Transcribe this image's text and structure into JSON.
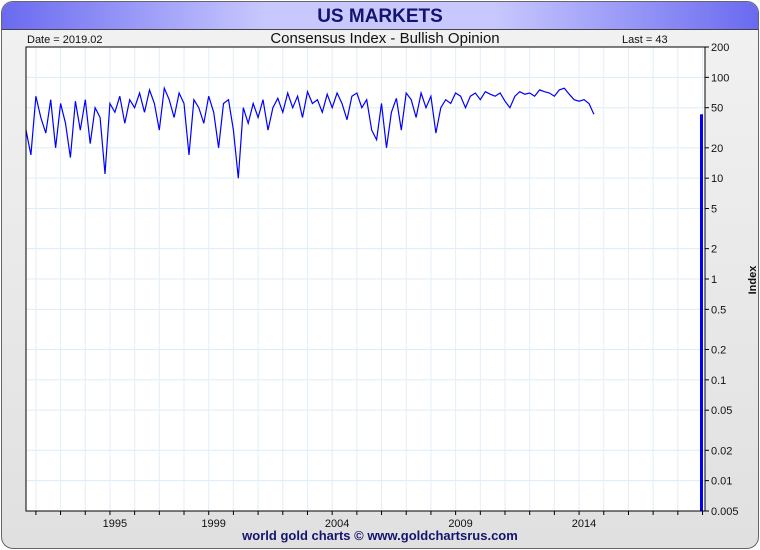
{
  "header": {
    "title": "US MARKETS"
  },
  "info": {
    "date": "Date = 2019.02",
    "last": "Last = 43"
  },
  "footer": {
    "credit": "world gold charts © www.goldchartsrus.com"
  },
  "chart_data": {
    "type": "line",
    "title": "Consensus Index - Bullish Opinion",
    "ylabel": "Index",
    "yscale": "log",
    "ylim": [
      0.005,
      200
    ],
    "yticks": [
      "200",
      "100",
      "50",
      "20",
      "10",
      "5",
      "2",
      "1",
      "0.5",
      "0.2",
      "0.1",
      "0.05",
      "0.02",
      "0.01",
      "0.005"
    ],
    "xticks": [
      "1995",
      "1999",
      "2004",
      "2009",
      "2014"
    ],
    "xlim": [
      1991.6,
      2019.1
    ],
    "grid": true,
    "series": [
      {
        "name": "Consensus Index",
        "color": "#0000ff",
        "x_start": 1991.6,
        "x_step": 0.2,
        "values": [
          30,
          17,
          65,
          40,
          28,
          60,
          20,
          55,
          35,
          16,
          58,
          30,
          60,
          22,
          50,
          40,
          11,
          55,
          45,
          65,
          35,
          60,
          50,
          70,
          45,
          75,
          55,
          30,
          78,
          60,
          40,
          70,
          55,
          17,
          60,
          50,
          35,
          65,
          45,
          20,
          55,
          60,
          30,
          10,
          50,
          35,
          55,
          40,
          60,
          30,
          50,
          62,
          45,
          70,
          50,
          65,
          40,
          72,
          55,
          60,
          45,
          68,
          50,
          70,
          55,
          38,
          65,
          70,
          50,
          60,
          30,
          24,
          55,
          20,
          45,
          62,
          30,
          70,
          60,
          40,
          70,
          50,
          65,
          28,
          50,
          60,
          55,
          70,
          65,
          50,
          65,
          70,
          60,
          72,
          68,
          65,
          70,
          58,
          50,
          65,
          72,
          68,
          70,
          65,
          75,
          72,
          70,
          65,
          75,
          78,
          68,
          60,
          58,
          60,
          55,
          43
        ]
      }
    ]
  }
}
